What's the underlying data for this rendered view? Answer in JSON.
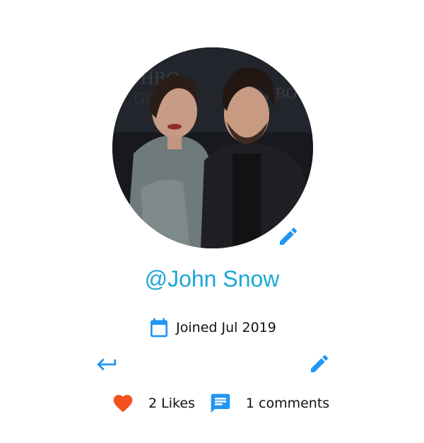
{
  "profile": {
    "handle": "@John Snow",
    "joined": "Joined Jul 2019",
    "avatar": "profile-photo"
  },
  "stats": {
    "likes": "2 Likes",
    "comments": "1 comments"
  },
  "icons": {
    "edit": "pencil-icon",
    "calendar": "calendar-icon",
    "back": "return-arrow-icon",
    "like": "heart-icon",
    "comment": "comment-icon"
  },
  "colors": {
    "accent": "#2196f3",
    "handle": "#1ba8d6",
    "heart": "#f4511e"
  }
}
